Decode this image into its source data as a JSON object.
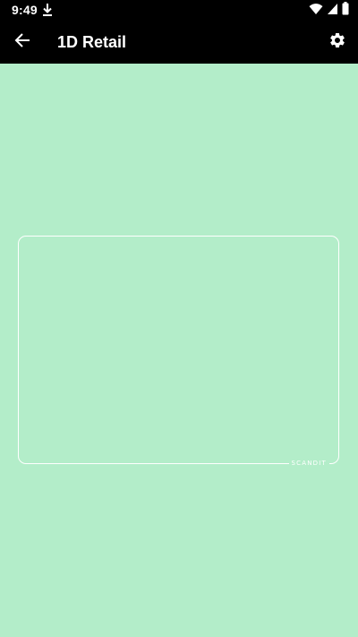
{
  "status_bar": {
    "time": "9:49",
    "icons": [
      "download-icon",
      "wifi-icon",
      "signal-icon",
      "battery-icon"
    ]
  },
  "app_bar": {
    "title": "1D Retail",
    "back_icon": "arrow-back-icon",
    "settings_icon": "gear-icon"
  },
  "scanner": {
    "brand_label": "SCANDIT"
  },
  "colors": {
    "camera_background": "#b3edc9",
    "bars": "#000000",
    "viewfinder": "#ffffff"
  }
}
